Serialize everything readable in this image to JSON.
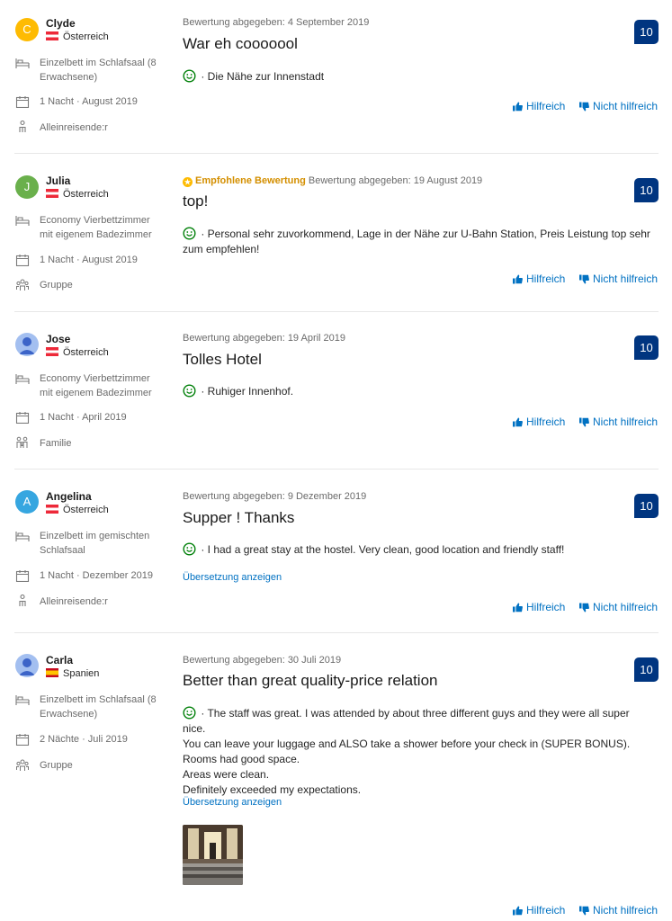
{
  "colors": {
    "accent": "#0071c2",
    "score_bg": "#003580",
    "positive": "#008009",
    "featured": "#d48f00"
  },
  "reviews": [
    {
      "initial": "C",
      "avatar_color": "#febb02",
      "name": "Clyde",
      "country": "Österreich",
      "flag": "at",
      "room": "Einzelbett im Schlafsaal (8 Erwachsene)",
      "stay": "1 Nacht · August 2019",
      "traveler": "Alleinreisende:r",
      "traveler_icon": "person-icon",
      "featured": "",
      "date": "Bewertung abgegeben: 4 September 2019",
      "title": "War eh cooooool",
      "score": "10",
      "positive": " · Die Nähe zur Innenstadt",
      "translate": "",
      "helpful": "Hilfreich",
      "not_helpful": "Nicht hilfreich"
    },
    {
      "initial": "J",
      "avatar_color": "#6ab04c",
      "name": "Julia",
      "country": "Österreich",
      "flag": "at",
      "room": "Economy Vierbettzimmer mit eigenem Badezimmer",
      "stay": "1 Nacht · August 2019",
      "traveler": "Gruppe",
      "traveler_icon": "group-icon",
      "featured": "Empfohlene Bewertung",
      "date": "Bewertung abgegeben: 19 August 2019",
      "title": "top!",
      "score": "10",
      "positive": " · Personal sehr zuvorkommend, Lage in der Nähe zur U-Bahn Station, Preis Leistung top sehr zum empfehlen!",
      "translate": "",
      "helpful": "Hilfreich",
      "not_helpful": "Nicht hilfreich"
    },
    {
      "initial": "",
      "avatar_color": "#a3bff0",
      "name": "Jose",
      "country": "Österreich",
      "flag": "at",
      "room": "Economy Vierbettzimmer mit eigenem Badezimmer",
      "stay": "1 Nacht · April 2019",
      "traveler": "Familie",
      "traveler_icon": "family-icon",
      "featured": "",
      "date": "Bewertung abgegeben: 19 April 2019",
      "title": "Tolles Hotel",
      "score": "10",
      "positive": " · Ruhiger Innenhof.",
      "translate": "",
      "helpful": "Hilfreich",
      "not_helpful": "Nicht hilfreich"
    },
    {
      "initial": "A",
      "avatar_color": "#36a6e0",
      "name": "Angelina",
      "country": "Österreich",
      "flag": "at",
      "room": "Einzelbett im gemischten Schlafsaal",
      "stay": "1 Nacht · Dezember 2019",
      "traveler": "Alleinreisende:r",
      "traveler_icon": "person-icon",
      "featured": "",
      "date": "Bewertung abgegeben: 9 Dezember 2019",
      "title": "Supper ! Thanks",
      "score": "10",
      "positive": " · I had a great stay at the hostel. Very clean, good location and friendly staff!",
      "translate": "Übersetzung anzeigen",
      "helpful": "Hilfreich",
      "not_helpful": "Nicht hilfreich"
    },
    {
      "initial": "",
      "avatar_color": "#a3bff0",
      "name": "Carla",
      "country": "Spanien",
      "flag": "es",
      "room": "Einzelbett im Schlafsaal (8 Erwachsene)",
      "stay": "2 Nächte · Juli 2019",
      "traveler": "Gruppe",
      "traveler_icon": "group-icon",
      "featured": "",
      "date": "Bewertung abgegeben: 30 Juli 2019",
      "title": "Better than great quality-price relation",
      "score": "10",
      "positive": " · The staff was great. I was attended by about three different guys and they were all super nice.",
      "positive_lines": [
        "You can leave your luggage and ALSO take a shower before your check in (SUPER BONUS).",
        "Rooms had good space.",
        "Areas were clean.",
        "Definitely exceeded my expectations."
      ],
      "translate": "Übersetzung anzeigen",
      "helpful": "Hilfreich",
      "not_helpful": "Nicht hilfreich"
    }
  ]
}
